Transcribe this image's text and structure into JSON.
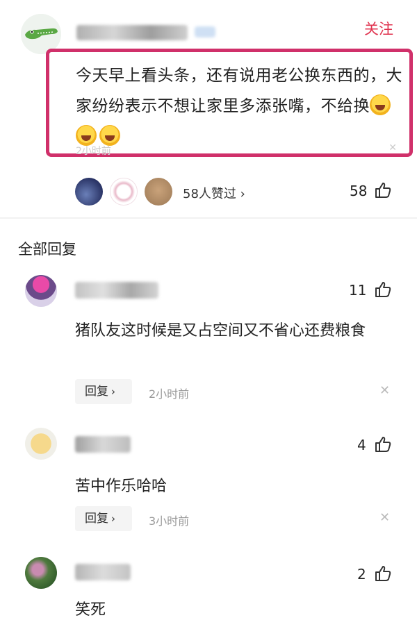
{
  "post": {
    "follow_label": "关注",
    "text": "今天早上看头条，还有说用老公换东西的，大家纷纷表示不想让家里多添张嘴，不给换",
    "emoji_icon": "laughing-crying-emoji",
    "emoji_count": 3,
    "time_faded": "2小时前",
    "likers_label": "58人赞过 ›",
    "like_count": "58"
  },
  "section_title": "全部回复",
  "comments": [
    {
      "text": "猪队友这时候是又占空间又不省心还费粮食",
      "likes": "11",
      "reply_label": "回复",
      "time": "2小时前"
    },
    {
      "text": "苦中作乐哈哈",
      "likes": "4",
      "reply_label": "回复",
      "time": "3小时前"
    },
    {
      "text": "笑死",
      "likes": "2"
    }
  ],
  "colors": {
    "accent": "#e0334f",
    "highlight_border": "#d0306a"
  }
}
